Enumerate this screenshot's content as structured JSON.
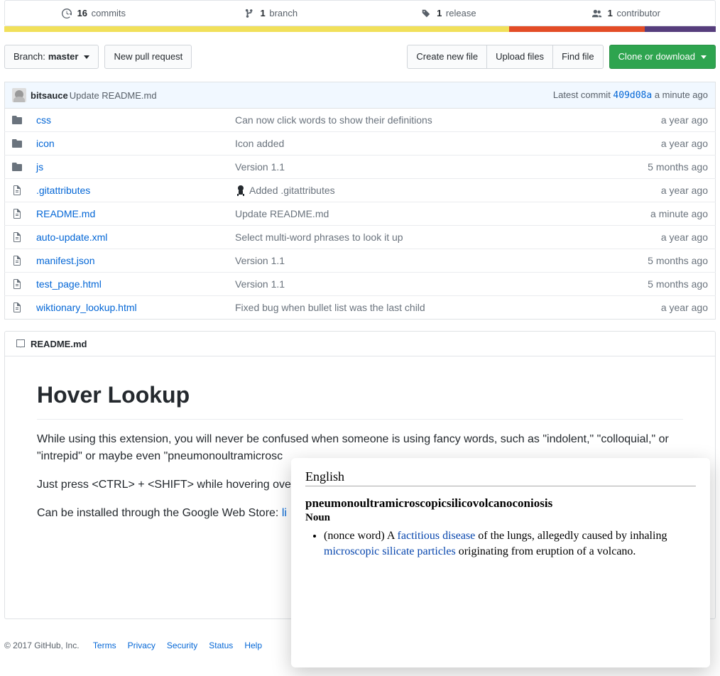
{
  "stats": {
    "commits": {
      "count": "16",
      "label": "commits"
    },
    "branches": {
      "count": "1",
      "label": "branch"
    },
    "releases": {
      "count": "1",
      "label": "release"
    },
    "contributors": {
      "count": "1",
      "label": "contributor"
    }
  },
  "langbar": [
    {
      "color": "#f1e05a",
      "width": "71%"
    },
    {
      "color": "#e34c26",
      "width": "19%"
    },
    {
      "color": "#563d7c",
      "width": "10%"
    }
  ],
  "toolbar": {
    "branch_prefix": "Branch: ",
    "branch_name": "master",
    "new_pr": "New pull request",
    "create_file": "Create new file",
    "upload": "Upload files",
    "find": "Find file",
    "clone": "Clone or download"
  },
  "commit": {
    "author": "bitsauce",
    "message": "Update README.md",
    "latest_label": "Latest commit ",
    "sha": "409d08a",
    "time": " a minute ago"
  },
  "files": [
    {
      "type": "dir",
      "name": "css",
      "msg": "Can now click words to show their definitions",
      "age": "a year ago",
      "avatar": false
    },
    {
      "type": "dir",
      "name": "icon",
      "msg": "Icon added",
      "age": "a year ago",
      "avatar": false
    },
    {
      "type": "dir",
      "name": "js",
      "msg": "Version 1.1",
      "age": "5 months ago",
      "avatar": false
    },
    {
      "type": "file",
      "name": ".gitattributes",
      "msg": "Added .gitattributes",
      "age": "a year ago",
      "avatar": true
    },
    {
      "type": "file",
      "name": "README.md",
      "msg": "Update README.md",
      "age": "a minute ago",
      "avatar": false
    },
    {
      "type": "file",
      "name": "auto-update.xml",
      "msg": "Select multi-word phrases to look it up",
      "age": "a year ago",
      "avatar": false
    },
    {
      "type": "file",
      "name": "manifest.json",
      "msg": "Version 1.1",
      "age": "5 months ago",
      "avatar": false
    },
    {
      "type": "file",
      "name": "test_page.html",
      "msg": "Version 1.1",
      "age": "5 months ago",
      "avatar": false
    },
    {
      "type": "file",
      "name": "wiktionary_lookup.html",
      "msg": "Fixed bug when bullet list was the last child",
      "age": "a year ago",
      "avatar": false
    }
  ],
  "readme": {
    "filename": "README.md",
    "title": "Hover Lookup",
    "p1": "While using this extension, you will never be confused when someone is using fancy words, such as \"indolent,\" \"colloquial,\" or \"intrepid\" or maybe even \"pneumonoultramicrosc",
    "p2": "Just press <CTRL> + <SHIFT> while hovering ove",
    "p3_pre": "Can be installed through the Google Web Store: ",
    "p3_link": "li"
  },
  "popup": {
    "lang": "English",
    "word": "pneumonoultramicroscopicsilicovolcanoconiosis",
    "pos": "Noun",
    "def_pre": "(nonce word) A ",
    "def_link1": "factitious disease",
    "def_mid": " of the lungs, allegedly caused by inhaling ",
    "def_link2": "microscopic silicate particles",
    "def_post": " originating from eruption of a volcano."
  },
  "footer": {
    "copyright": "© 2017 GitHub, Inc.",
    "links": [
      "Terms",
      "Privacy",
      "Security",
      "Status",
      "Help"
    ]
  }
}
